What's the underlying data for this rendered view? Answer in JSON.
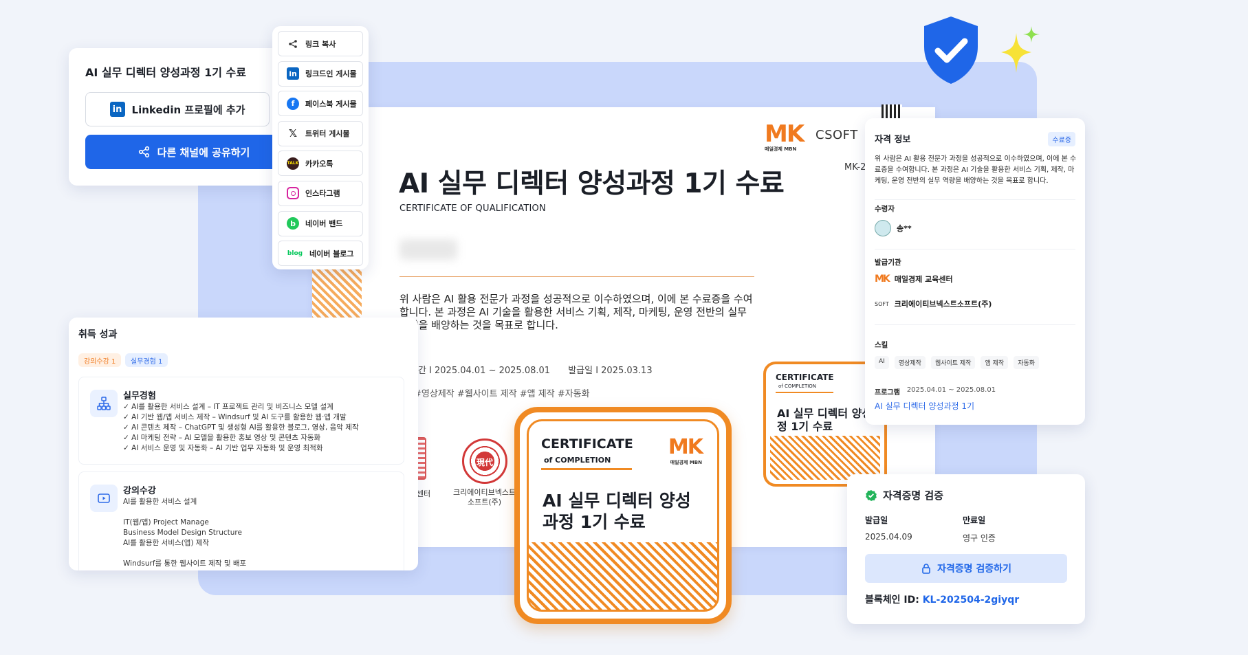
{
  "share_card": {
    "title": "AI 실무 디렉터 양성과정 1기 수료",
    "linkedin_button": "Linkedin 프로필에 추가",
    "share_button": "다른 채널에 공유하기"
  },
  "share_menu": {
    "items": [
      {
        "label": "링크 복사",
        "icon": "link-share-icon"
      },
      {
        "label": "링크드인 게시물",
        "icon": "linkedin-icon"
      },
      {
        "label": "페이스북 게시물",
        "icon": "facebook-icon"
      },
      {
        "label": "트위터 게시물",
        "icon": "x-twitter-icon"
      },
      {
        "label": "카카오톡",
        "icon": "kakaotalk-icon"
      },
      {
        "label": "인스타그램",
        "icon": "instagram-icon"
      },
      {
        "label": "네이버 밴드",
        "icon": "naver-band-icon"
      },
      {
        "label": "네이버 블로그",
        "icon": "naver-blog-icon"
      }
    ]
  },
  "document": {
    "title": "AI 실무 디렉터 양성과정 1기 수료",
    "subtitle": "CERTIFICATE OF QUALIFICATION",
    "body": "위 사람은 AI 활용 전문가 과정을 성공적으로 이수하였으며, 이에 본 수료증을 수여합니다. 본 과정은 AI 기술을 활용한 서비스 기획, 제작, 마케팅, 운영 전반의 실무 역량을 배양하는 것을 목표로 합니다.",
    "period": "기간 I  2025.04.01 ~ 2025.08.01",
    "issued": "발급일 I  2025.03.13",
    "tags": "#영상제작 #웹사이트 제작 #앱 제작 #자동화",
    "code": "MK-2",
    "seal1_caption": "제 교육센터",
    "seal2_caption_1": "크리에이티브넥스트",
    "seal2_caption_2": "소프트(주)",
    "seal2_text": "現代",
    "mk_logo": "MK",
    "mk_sub": "매일경제 MBN",
    "csoft_logo": "SOFT"
  },
  "big_cert": {
    "line1": "CERTIFICATE",
    "line2": "of COMPLETION",
    "title": "AI 실무 디렉터 양성 과정 1기 수료",
    "mk_logo": "MK",
    "mk_sub": "매일경제 MBN"
  },
  "mini_cert": {
    "line1": "CERTIFICATE",
    "line2": "of COMPLETION",
    "title": "AI 실무 디렉터 양성 정 1기 수료",
    "mk_logo": "M"
  },
  "achievements": {
    "title": "취득 성과",
    "badges": [
      "강의수강 1",
      "실무경험 1"
    ],
    "experience": {
      "heading": "실무경험",
      "lines": [
        "✓ AI를 활용한 서비스 설계 – IT 프로젝트 관리 및 비즈니스 모델 설계",
        "✓ AI 기반 웹/앱 서비스 제작 – Windsurf 및 AI 도구를 활용한 웹·앱 개발",
        "✓ AI 콘텐츠 제작 – ChatGPT 및 생성형 AI를 활용한 블로그, 영상, 음악 제작",
        "✓ AI 마케팅 전략 – AI 모델을 활용한 홍보 영상 및 콘텐츠 자동화",
        "✓ AI 서비스 운영 및 자동화 – AI 기반 업무 자동화 및 운영 최적화"
      ]
    },
    "lecture": {
      "heading": "강의수강",
      "lines": [
        "AI를 활용한 서비스 설계",
        "",
        "IT(웹/앱) Project Manage",
        "Business Model Design Structure",
        "AI를 활용한 서비스(앱) 제작",
        "",
        "Windsurf를 통한 웹사이트 제작 및 배포"
      ]
    }
  },
  "info_panel": {
    "title": "자격 정보",
    "tag": "수료증",
    "description": "위 사람은 AI 활용 전문가 과정을 성공적으로 이수하였으며, 이에 본 수료증을 수여합니다. 본 과정은 AI 기술을 활용한 서비스 기획, 제작, 마케팅, 운영 전반의 실무 역량을 배양하는 것을 목표로 합니다.",
    "recipient_label": "수령자",
    "recipient": "송**",
    "issuer_label": "발급기관",
    "issuer1": "매일경제 교육센터",
    "issuer1_logo": "MK",
    "issuer2": "크리에이티브넥스트소프트(주)",
    "issuer2_logo": "SOFT",
    "skills_label": "스킬",
    "skills": [
      "AI",
      "영상제작",
      "웹사이트 제작",
      "앱 제작",
      "자동화"
    ],
    "program_label": "프로그램",
    "program_period": "2025.04.01 ~ 2025.08.01",
    "program_name": "AI 실무 디렉터 양성과정 1기"
  },
  "verify": {
    "title": "자격증명 검증",
    "issued_label": "발급일",
    "expiry_label": "만료일",
    "issued_value": "2025.04.09",
    "expiry_value": "영구 인증",
    "button": "자격증명 검증하기",
    "chain_label": "블록체인 ID: ",
    "chain_id": "KL-202504-2giyqr"
  },
  "colors": {
    "accent": "#1f66e8",
    "orange": "#f08a23",
    "background": "#f1f4fa"
  }
}
